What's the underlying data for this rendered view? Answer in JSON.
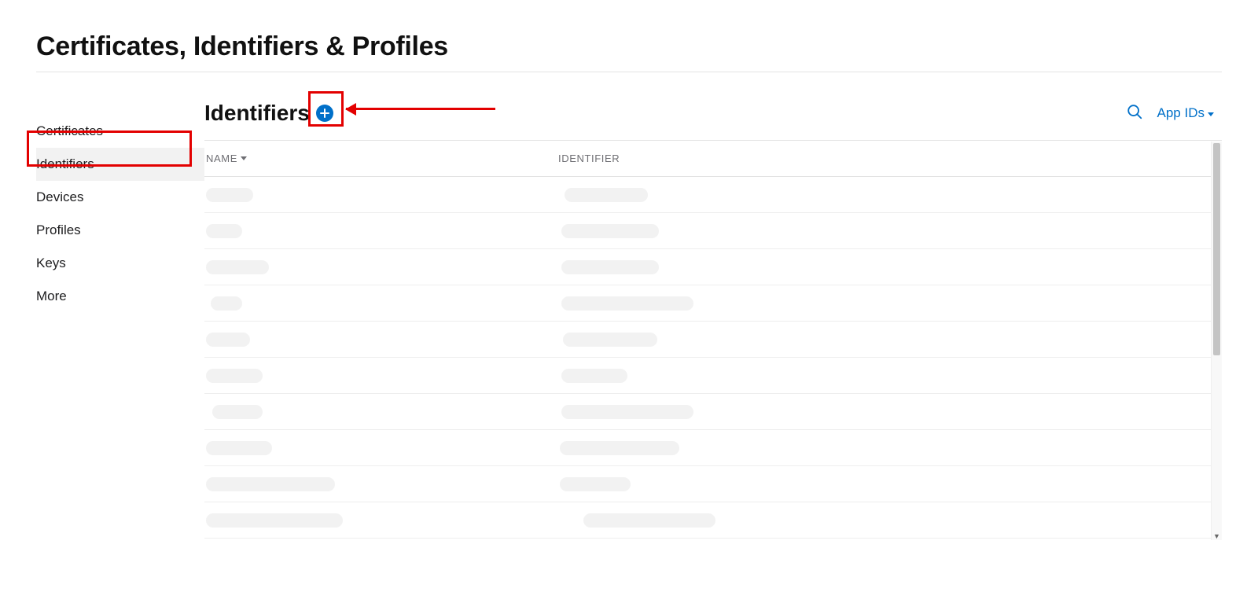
{
  "page": {
    "title": "Certificates, Identifiers & Profiles"
  },
  "sidebar": {
    "items": [
      {
        "label": "Certificates",
        "active": false
      },
      {
        "label": "Identifiers",
        "active": true
      },
      {
        "label": "Devices",
        "active": false
      },
      {
        "label": "Profiles",
        "active": false
      },
      {
        "label": "Keys",
        "active": false
      },
      {
        "label": "More",
        "active": false
      }
    ]
  },
  "content": {
    "section_title": "Identifiers",
    "filter_label": "App IDs",
    "columns": {
      "name": "NAME",
      "identifier": "IDENTIFIER"
    },
    "rows": [
      {
        "name": "",
        "identifier": ""
      },
      {
        "name": "",
        "identifier": ""
      },
      {
        "name": "",
        "identifier": ""
      },
      {
        "name": "",
        "identifier": ""
      },
      {
        "name": "",
        "identifier": ""
      },
      {
        "name": "",
        "identifier": ""
      },
      {
        "name": "",
        "identifier": ""
      },
      {
        "name": "",
        "identifier": ""
      },
      {
        "name": "",
        "identifier": ""
      },
      {
        "name": "",
        "identifier": ""
      }
    ]
  },
  "annotations": {
    "highlight_sidebar_item": "Identifiers",
    "highlight_add_button": true,
    "arrow_to_add_button": true
  }
}
